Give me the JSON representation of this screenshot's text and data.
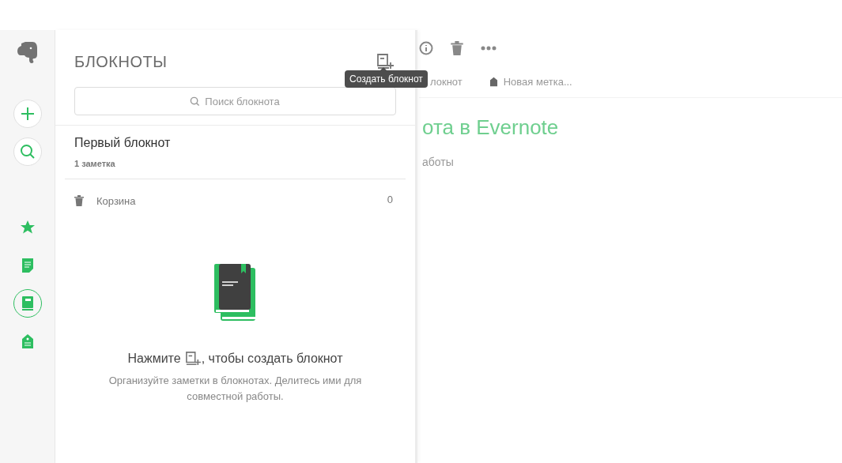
{
  "nav": [
    {
      "selected": false
    },
    {
      "selected": false
    },
    {
      "selected": true
    },
    {
      "selected": false
    }
  ],
  "panel": {
    "title": "БЛОКНОТЫ",
    "tooltip": "Создать блокнот",
    "search": {
      "placeholder": "Поиск блокнота"
    },
    "notebooks": [
      {
        "name": "Первый блокнот",
        "count": "1 заметка"
      }
    ],
    "trash": {
      "label": "Корзина",
      "count": "0"
    },
    "empty": {
      "before": "Нажмите",
      "after": ", чтобы создать блокнот",
      "text": "Организуйте заметки в блокнотах. Делитесь ими для совместной работы."
    }
  },
  "background_note": {
    "notebook": "локнот",
    "tag": "Новая метка...",
    "title": "ота в Evernote",
    "body": "аботы"
  }
}
